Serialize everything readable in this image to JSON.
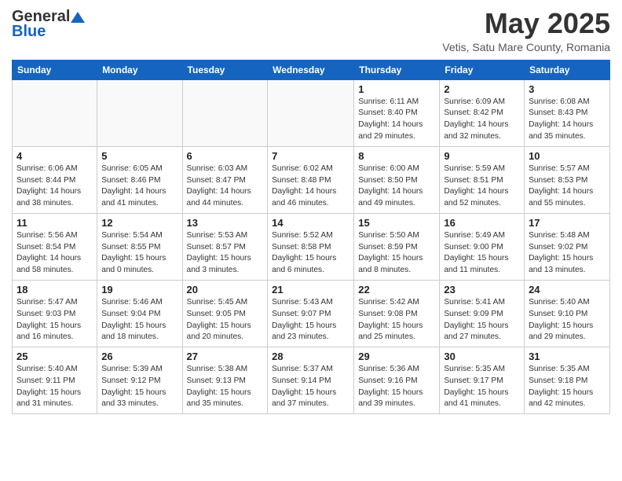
{
  "logo": {
    "general": "General",
    "blue": "Blue"
  },
  "title": "May 2025",
  "subtitle": "Vetis, Satu Mare County, Romania",
  "weekdays": [
    "Sunday",
    "Monday",
    "Tuesday",
    "Wednesday",
    "Thursday",
    "Friday",
    "Saturday"
  ],
  "weeks": [
    [
      {
        "day": "",
        "content": ""
      },
      {
        "day": "",
        "content": ""
      },
      {
        "day": "",
        "content": ""
      },
      {
        "day": "",
        "content": ""
      },
      {
        "day": "1",
        "content": "Sunrise: 6:11 AM\nSunset: 8:40 PM\nDaylight: 14 hours\nand 29 minutes."
      },
      {
        "day": "2",
        "content": "Sunrise: 6:09 AM\nSunset: 8:42 PM\nDaylight: 14 hours\nand 32 minutes."
      },
      {
        "day": "3",
        "content": "Sunrise: 6:08 AM\nSunset: 8:43 PM\nDaylight: 14 hours\nand 35 minutes."
      }
    ],
    [
      {
        "day": "4",
        "content": "Sunrise: 6:06 AM\nSunset: 8:44 PM\nDaylight: 14 hours\nand 38 minutes."
      },
      {
        "day": "5",
        "content": "Sunrise: 6:05 AM\nSunset: 8:46 PM\nDaylight: 14 hours\nand 41 minutes."
      },
      {
        "day": "6",
        "content": "Sunrise: 6:03 AM\nSunset: 8:47 PM\nDaylight: 14 hours\nand 44 minutes."
      },
      {
        "day": "7",
        "content": "Sunrise: 6:02 AM\nSunset: 8:48 PM\nDaylight: 14 hours\nand 46 minutes."
      },
      {
        "day": "8",
        "content": "Sunrise: 6:00 AM\nSunset: 8:50 PM\nDaylight: 14 hours\nand 49 minutes."
      },
      {
        "day": "9",
        "content": "Sunrise: 5:59 AM\nSunset: 8:51 PM\nDaylight: 14 hours\nand 52 minutes."
      },
      {
        "day": "10",
        "content": "Sunrise: 5:57 AM\nSunset: 8:53 PM\nDaylight: 14 hours\nand 55 minutes."
      }
    ],
    [
      {
        "day": "11",
        "content": "Sunrise: 5:56 AM\nSunset: 8:54 PM\nDaylight: 14 hours\nand 58 minutes."
      },
      {
        "day": "12",
        "content": "Sunrise: 5:54 AM\nSunset: 8:55 PM\nDaylight: 15 hours\nand 0 minutes."
      },
      {
        "day": "13",
        "content": "Sunrise: 5:53 AM\nSunset: 8:57 PM\nDaylight: 15 hours\nand 3 minutes."
      },
      {
        "day": "14",
        "content": "Sunrise: 5:52 AM\nSunset: 8:58 PM\nDaylight: 15 hours\nand 6 minutes."
      },
      {
        "day": "15",
        "content": "Sunrise: 5:50 AM\nSunset: 8:59 PM\nDaylight: 15 hours\nand 8 minutes."
      },
      {
        "day": "16",
        "content": "Sunrise: 5:49 AM\nSunset: 9:00 PM\nDaylight: 15 hours\nand 11 minutes."
      },
      {
        "day": "17",
        "content": "Sunrise: 5:48 AM\nSunset: 9:02 PM\nDaylight: 15 hours\nand 13 minutes."
      }
    ],
    [
      {
        "day": "18",
        "content": "Sunrise: 5:47 AM\nSunset: 9:03 PM\nDaylight: 15 hours\nand 16 minutes."
      },
      {
        "day": "19",
        "content": "Sunrise: 5:46 AM\nSunset: 9:04 PM\nDaylight: 15 hours\nand 18 minutes."
      },
      {
        "day": "20",
        "content": "Sunrise: 5:45 AM\nSunset: 9:05 PM\nDaylight: 15 hours\nand 20 minutes."
      },
      {
        "day": "21",
        "content": "Sunrise: 5:43 AM\nSunset: 9:07 PM\nDaylight: 15 hours\nand 23 minutes."
      },
      {
        "day": "22",
        "content": "Sunrise: 5:42 AM\nSunset: 9:08 PM\nDaylight: 15 hours\nand 25 minutes."
      },
      {
        "day": "23",
        "content": "Sunrise: 5:41 AM\nSunset: 9:09 PM\nDaylight: 15 hours\nand 27 minutes."
      },
      {
        "day": "24",
        "content": "Sunrise: 5:40 AM\nSunset: 9:10 PM\nDaylight: 15 hours\nand 29 minutes."
      }
    ],
    [
      {
        "day": "25",
        "content": "Sunrise: 5:40 AM\nSunset: 9:11 PM\nDaylight: 15 hours\nand 31 minutes."
      },
      {
        "day": "26",
        "content": "Sunrise: 5:39 AM\nSunset: 9:12 PM\nDaylight: 15 hours\nand 33 minutes."
      },
      {
        "day": "27",
        "content": "Sunrise: 5:38 AM\nSunset: 9:13 PM\nDaylight: 15 hours\nand 35 minutes."
      },
      {
        "day": "28",
        "content": "Sunrise: 5:37 AM\nSunset: 9:14 PM\nDaylight: 15 hours\nand 37 minutes."
      },
      {
        "day": "29",
        "content": "Sunrise: 5:36 AM\nSunset: 9:16 PM\nDaylight: 15 hours\nand 39 minutes."
      },
      {
        "day": "30",
        "content": "Sunrise: 5:35 AM\nSunset: 9:17 PM\nDaylight: 15 hours\nand 41 minutes."
      },
      {
        "day": "31",
        "content": "Sunrise: 5:35 AM\nSunset: 9:18 PM\nDaylight: 15 hours\nand 42 minutes."
      }
    ]
  ]
}
